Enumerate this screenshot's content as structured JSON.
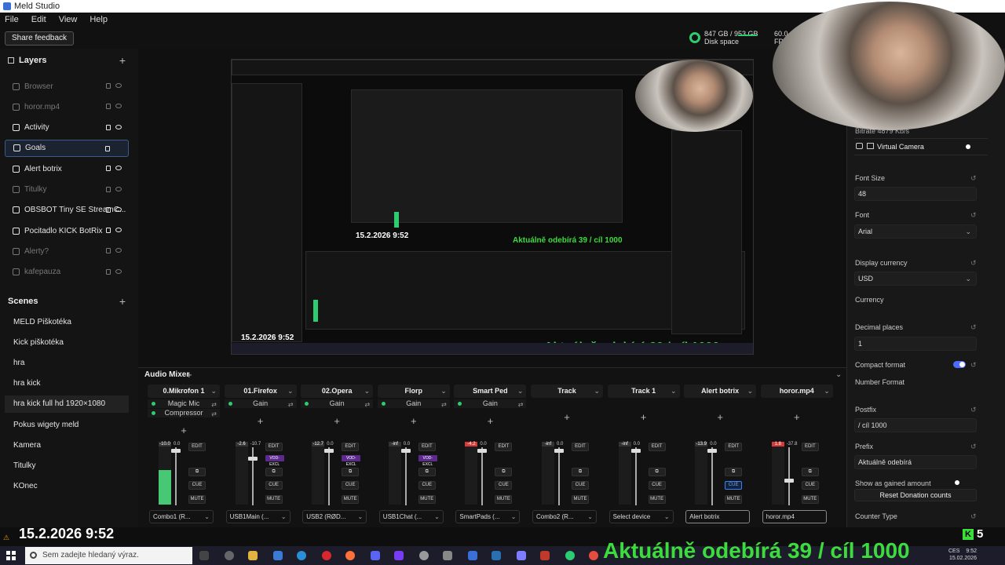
{
  "window": {
    "title": "Meld Studio"
  },
  "menu": [
    "File",
    "Edit",
    "View",
    "Help"
  ],
  "toolbar": {
    "share_feedback": "Share feedback"
  },
  "status": {
    "disk_value": "847 GB / 953 GB",
    "disk_label": "Disk space",
    "fps_value": "60.0",
    "fps_label": "FPS"
  },
  "layers": {
    "title": "Layers",
    "items": [
      {
        "label": "Browser",
        "dim": true
      },
      {
        "label": "horor.mp4",
        "dim": true
      },
      {
        "label": "Activity",
        "dim": false
      },
      {
        "label": "Goals",
        "dim": false
      },
      {
        "label": "Alert botrix",
        "dim": false
      },
      {
        "label": "Titulky",
        "dim": true
      },
      {
        "label": "OBSBOT Tiny SE StreamC...",
        "dim": false
      },
      {
        "label": "Pocitadlo KICK BotRix",
        "dim": false
      },
      {
        "label": "Alerty?",
        "dim": true
      },
      {
        "label": "kafepauza",
        "dim": true
      }
    ]
  },
  "scenes": {
    "title": "Scenes",
    "items": [
      "MELD Piškotéka",
      "Kick piškotéka",
      "hra",
      "hra kick",
      "hra kick full hd 1920×1080",
      "Pokus wigety meld",
      "Kamera",
      "Titulky",
      "KOnec"
    ]
  },
  "overlay": {
    "datetime": "15.2.2026 9:52",
    "subscribers": "Aktuálně odebírá 39 / cíl 1000",
    "preview_datetime": "15.2.2026 9:52",
    "preview_subscribers": "Aktuálně odebírá 39 / cíl 1000",
    "kick_count": "5"
  },
  "properties": {
    "bitrate": "Bitrate  4879 Kb/s",
    "virtual_camera": "Virtual Camera",
    "font_size_label": "Font Size",
    "font_size_value": "48",
    "font_label": "Font",
    "font_value": "Arial",
    "currency_label": "Display currency",
    "currency_value": "USD",
    "currency_text": "Currency",
    "decimal_label": "Decimal places",
    "decimal_value": "1",
    "compact_label": "Compact format",
    "number_format_label": "Number Format",
    "postfix_label": "Postfix",
    "postfix_value": "/ cíl 1000",
    "prefix_label": "Prefix",
    "prefix_value": "Aktuálně odebírá",
    "gained_label": "Show as gained amount",
    "reset_button": "Reset Donation counts",
    "counter_type_label": "Counter Type"
  },
  "mixer": {
    "title": "Audio Mixer",
    "buttons": {
      "edit": "EDIT",
      "cue": "CUE",
      "mute": "MUTE",
      "vod": "VOD-EXCL"
    },
    "channels": [
      {
        "name": "0.Mikrofon 1",
        "effects": [
          "Magic Mic",
          "Compressor"
        ],
        "db": "-10.0",
        "vol": "0.0",
        "device": "Combo1 (R...",
        "vod": false,
        "cue_on": false
      },
      {
        "name": "01.Firefox",
        "effects": [
          "Gain"
        ],
        "db": "-2.6",
        "vol": "-10.7",
        "device": "USB1Main (...",
        "vod": true,
        "cue_on": false
      },
      {
        "name": "02.Opera",
        "effects": [
          "Gain"
        ],
        "db": "-12.7",
        "vol": "0.0",
        "device": "USB2 (RØD...",
        "vod": true,
        "cue_on": false
      },
      {
        "name": "Florp",
        "effects": [
          "Gain"
        ],
        "db": "-inf",
        "vol": "0.0",
        "device": "USB1Chat (...",
        "vod": true,
        "cue_on": false
      },
      {
        "name": "Smart Ped",
        "effects": [
          "Gain"
        ],
        "db": "-4.2",
        "vol": "0.0",
        "device": "SmartPads (...",
        "vod": false,
        "cue_on": false
      },
      {
        "name": "Track",
        "effects": [],
        "db": "-inf",
        "vol": "0.0",
        "device": "Combo2 (R...",
        "vod": false,
        "cue_on": false
      },
      {
        "name": "Track 1",
        "effects": [],
        "db": "-inf",
        "vol": "0.0",
        "device": "Select device",
        "vod": false,
        "cue_on": false
      },
      {
        "name": "Alert botrix",
        "effects": [],
        "db": "-13.9",
        "vol": "0.0",
        "device": "Alert botrix",
        "vod": false,
        "cue_on": true
      },
      {
        "name": "horor.mp4",
        "effects": [],
        "db": "1.8",
        "vol": "-37.8",
        "device": "horor.mp4",
        "vod": false,
        "cue_on": false
      }
    ]
  },
  "taskbar": {
    "search_placeholder": "Sem zadejte hledaný výraz.",
    "lang": "CES",
    "time": "9:52",
    "date": "15.02.2026"
  },
  "colors": {
    "accent_green": "#3ddc3d",
    "meter_green": "#48c774",
    "toggle_blue": "#4b6bff"
  }
}
